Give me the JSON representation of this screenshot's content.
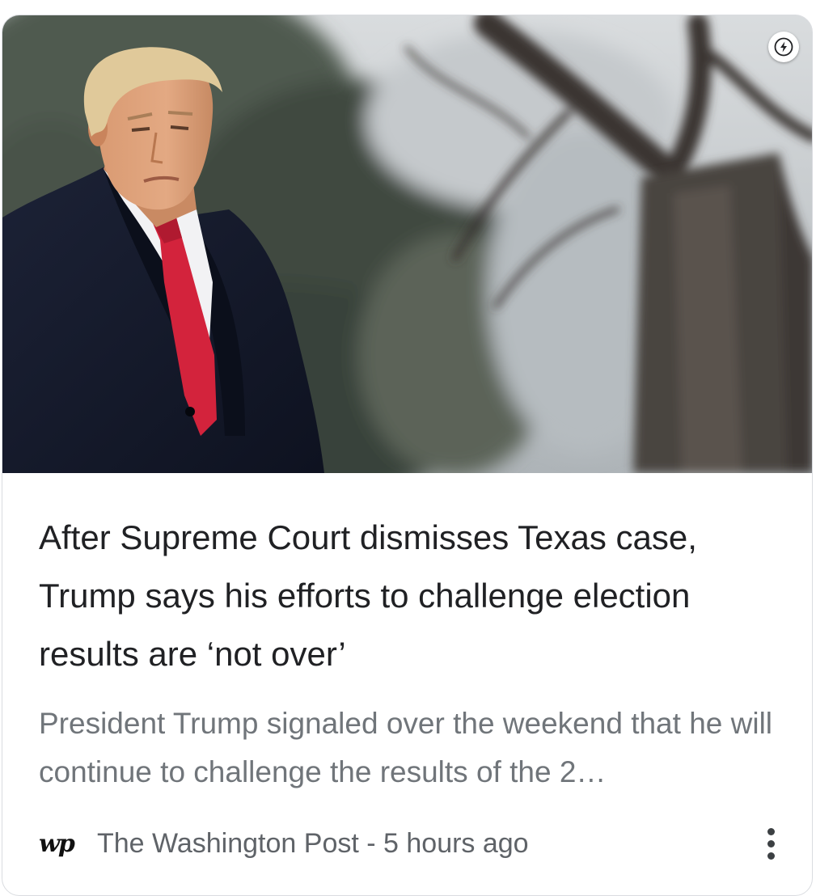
{
  "card": {
    "headline": "After Supreme Court dismisses Texas case, Trump says his efforts to challenge election results are ‘not over’",
    "snippet": "President Trump signaled over the weekend that he will continue to challenge the results of the 2…",
    "publisher_logo": "wp",
    "source": "The Washington Post",
    "separator": " - ",
    "time": "5 hours ago",
    "badge_icon": "amp-lightning-icon",
    "menu_icon": "more-vert-icon"
  }
}
